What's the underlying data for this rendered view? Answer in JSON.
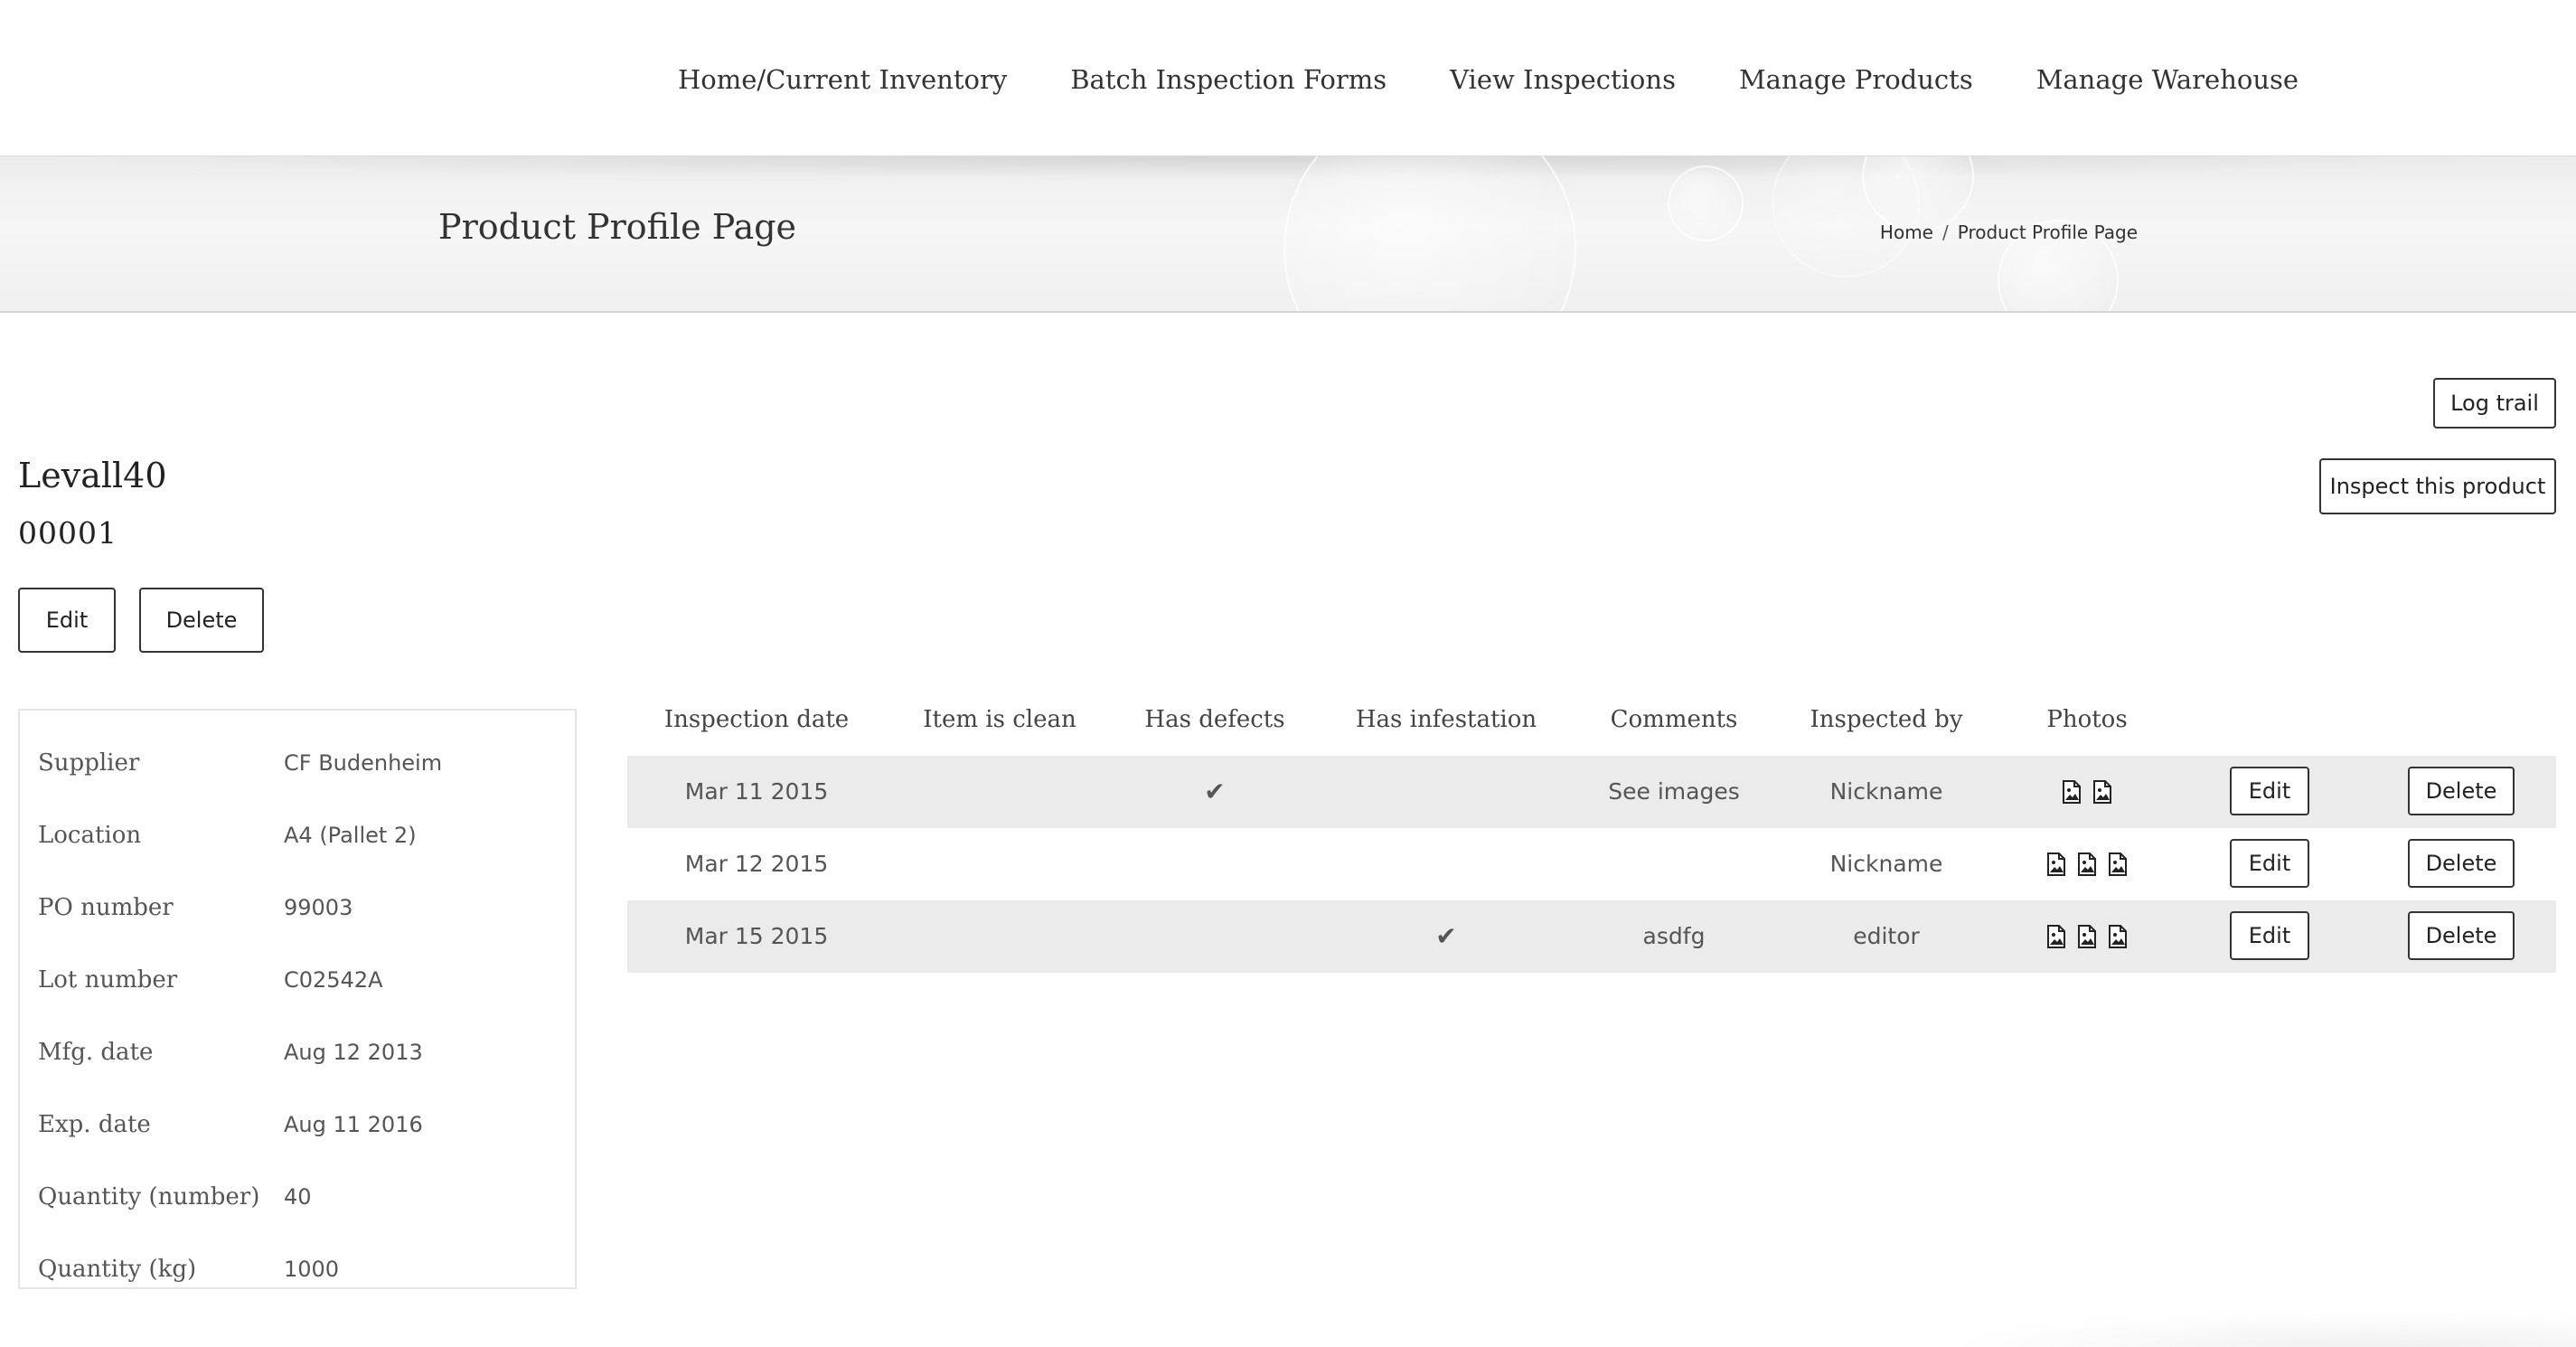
{
  "nav": {
    "items": [
      {
        "label": "Home/Current Inventory"
      },
      {
        "label": "Batch Inspection Forms"
      },
      {
        "label": "View Inspections"
      },
      {
        "label": "Manage Products"
      },
      {
        "label": "Manage Warehouse"
      }
    ]
  },
  "banner": {
    "title": "Product Profile Page",
    "breadcrumb": {
      "home": "Home",
      "separator": "/",
      "current": "Product Profile Page"
    }
  },
  "actions": {
    "log_trail": "Log trail",
    "inspect": "Inspect this product"
  },
  "product": {
    "name": "Levall40",
    "code": "00001",
    "edit_label": "Edit",
    "delete_label": "Delete"
  },
  "details": [
    {
      "label": "Supplier",
      "value": "CF Budenheim"
    },
    {
      "label": "Location",
      "value": "A4 (Pallet 2)"
    },
    {
      "label": "PO number",
      "value": "99003"
    },
    {
      "label": "Lot number",
      "value": "C02542A"
    },
    {
      "label": "Mfg. date",
      "value": "Aug 12 2013"
    },
    {
      "label": "Exp. date",
      "value": "Aug 11 2016"
    },
    {
      "label": "Quantity (number)",
      "value": "40"
    },
    {
      "label": "Quantity (kg)",
      "value": "1000"
    }
  ],
  "inspections": {
    "headers": [
      "Inspection date",
      "Item is clean",
      "Has defects",
      "Has infestation",
      "Comments",
      "Inspected by",
      "Photos"
    ],
    "rows": [
      {
        "date": "Mar 11 2015",
        "clean": false,
        "defects": true,
        "infestation": false,
        "comments": "See images",
        "inspected_by": "Nickname",
        "photos": 2,
        "edit": "Edit",
        "delete": "Delete"
      },
      {
        "date": "Mar 12 2015",
        "clean": false,
        "defects": false,
        "infestation": false,
        "comments": "",
        "inspected_by": "Nickname",
        "photos": 3,
        "edit": "Edit",
        "delete": "Delete"
      },
      {
        "date": "Mar 15 2015",
        "clean": false,
        "defects": false,
        "infestation": true,
        "comments": "asdfg",
        "inspected_by": "editor",
        "photos": 3,
        "edit": "Edit",
        "delete": "Delete"
      }
    ],
    "check_icon": "check-icon",
    "photo_icon": "image-file-icon"
  }
}
